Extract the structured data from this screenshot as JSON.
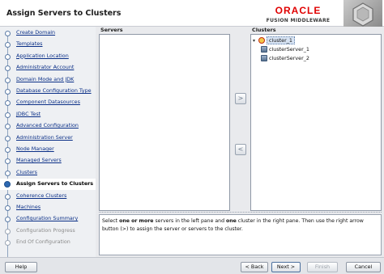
{
  "header": {
    "title": "Assign Servers to Clusters",
    "brand_name": "ORACLE",
    "brand_product": "FUSION MIDDLEWARE"
  },
  "nav": {
    "items": [
      {
        "label": "Create Domain",
        "state": "link"
      },
      {
        "label": "Templates",
        "state": "link"
      },
      {
        "label": "Application Location",
        "state": "link"
      },
      {
        "label": "Administrator Account",
        "state": "link"
      },
      {
        "label": "Domain Mode and JDK",
        "state": "link"
      },
      {
        "label": "Database Configuration Type",
        "state": "link"
      },
      {
        "label": "Component Datasources",
        "state": "link"
      },
      {
        "label": "JDBC Test",
        "state": "link"
      },
      {
        "label": "Advanced Configuration",
        "state": "link"
      },
      {
        "label": "Administration Server",
        "state": "link"
      },
      {
        "label": "Node Manager",
        "state": "link"
      },
      {
        "label": "Managed Servers",
        "state": "link"
      },
      {
        "label": "Clusters",
        "state": "link"
      },
      {
        "label": "Assign Servers to Clusters",
        "state": "current"
      },
      {
        "label": "Coherence Clusters",
        "state": "link"
      },
      {
        "label": "Machines",
        "state": "link"
      },
      {
        "label": "Configuration Summary",
        "state": "link"
      },
      {
        "label": "Configuration Progress",
        "state": "disabled"
      },
      {
        "label": "End Of Configuration",
        "state": "disabled"
      }
    ]
  },
  "servers_pane": {
    "header": "Servers",
    "items": []
  },
  "clusters_pane": {
    "header": "Clusters",
    "cluster": "cluster_1",
    "servers": [
      "clusterServer_1",
      "clusterServer_2"
    ]
  },
  "arrows": {
    "assign": ">",
    "unassign": "<"
  },
  "instructions": {
    "part1": "Select ",
    "bold1": "one or more",
    "part2": " servers in the left pane and ",
    "bold2": "one",
    "part3": " cluster in the right pane. Then use the right arrow button (>) to assign the server or servers to the cluster."
  },
  "footer": {
    "help": "Help",
    "back": "< Back",
    "next": "Next >",
    "finish": "Finish",
    "cancel": "Cancel"
  }
}
